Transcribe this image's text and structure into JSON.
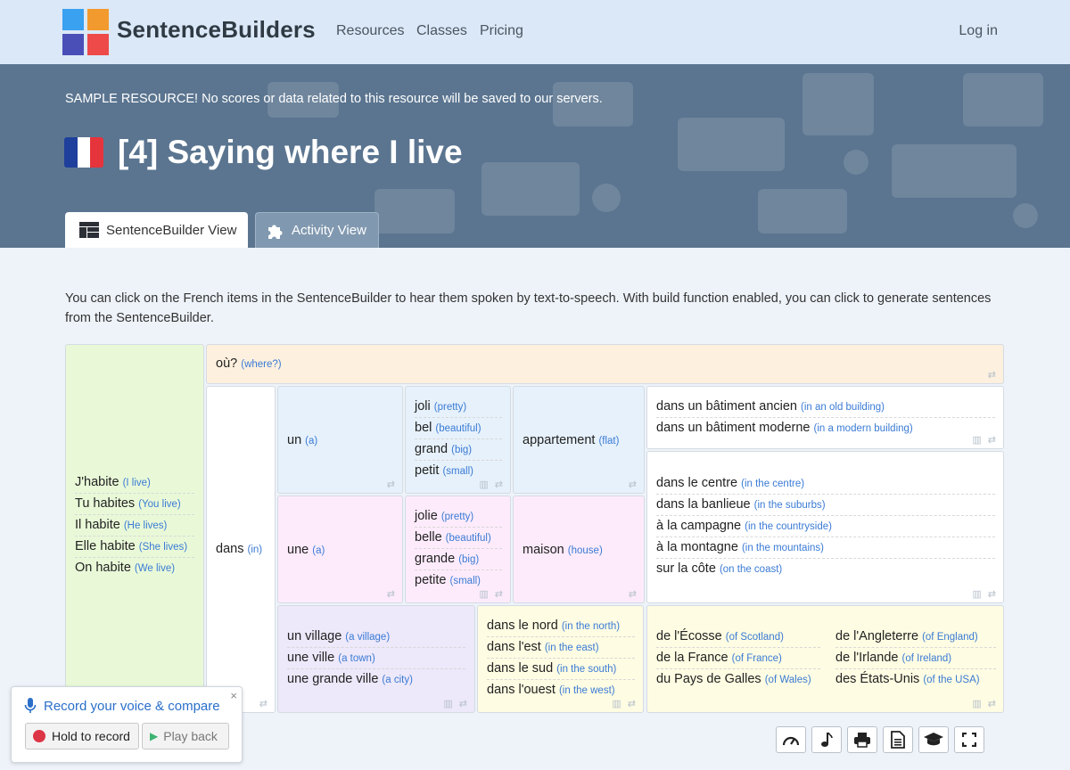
{
  "nav": {
    "brand": "SentenceBuilders",
    "links": [
      "Resources",
      "Classes",
      "Pricing"
    ],
    "login": "Log in",
    "logo_colors": [
      "#3aa0f0",
      "#f39a2e",
      "#4a4fb8",
      "#ee4a4a"
    ]
  },
  "hero": {
    "notice": "SAMPLE RESOURCE! No scores or data related to this resource will be saved to our servers.",
    "title": "[4] Saying where I live",
    "flag_colors": [
      "#1f3f9c",
      "#ffffff",
      "#e5343c"
    ],
    "tabs": [
      {
        "label": "SentenceBuilder View",
        "icon": "dashboard-icon",
        "active": true
      },
      {
        "label": "Activity View",
        "icon": "puzzle-icon",
        "active": false
      }
    ]
  },
  "intro": "You can click on the French items in the SentenceBuilder to hear them spoken by text-to-speech. With build function enabled, you can click to generate sentences from the SentenceBuilder.",
  "builder": {
    "subjects": [
      {
        "fr": "J'habite",
        "en": "(I live)"
      },
      {
        "fr": "Tu habites",
        "en": "(You live)"
      },
      {
        "fr": "Il habite",
        "en": "(He lives)"
      },
      {
        "fr": "Elle habite",
        "en": "(She lives)"
      },
      {
        "fr": "On habite",
        "en": "(We live)"
      }
    ],
    "question": {
      "fr": "où?",
      "en": "(where?)"
    },
    "dans": {
      "fr": "dans",
      "en": "(in)"
    },
    "un": {
      "fr": "un",
      "en": "(a)"
    },
    "une": {
      "fr": "une",
      "en": "(a)"
    },
    "adj_masc": [
      {
        "fr": "joli",
        "en": "(pretty)"
      },
      {
        "fr": "bel",
        "en": "(beautiful)"
      },
      {
        "fr": "grand",
        "en": "(big)"
      },
      {
        "fr": "petit",
        "en": "(small)"
      }
    ],
    "adj_fem": [
      {
        "fr": "jolie",
        "en": "(pretty)"
      },
      {
        "fr": "belle",
        "en": "(beautiful)"
      },
      {
        "fr": "grande",
        "en": "(big)"
      },
      {
        "fr": "petite",
        "en": "(small)"
      }
    ],
    "appartement": {
      "fr": "appartement",
      "en": "(flat)"
    },
    "maison": {
      "fr": "maison",
      "en": "(house)"
    },
    "buildings": [
      {
        "fr": "dans un bâtiment ancien",
        "en": "(in an old building)"
      },
      {
        "fr": "dans un bâtiment moderne",
        "en": "(in a modern building)"
      }
    ],
    "places": [
      {
        "fr": "dans le centre",
        "en": "(in the centre)"
      },
      {
        "fr": "dans la banlieue",
        "en": "(in the suburbs)"
      },
      {
        "fr": "à la campagne",
        "en": "(in the countryside)"
      },
      {
        "fr": "à la montagne",
        "en": "(in the mountains)"
      },
      {
        "fr": "sur la côte",
        "en": "(on the coast)"
      }
    ],
    "settlements": [
      {
        "fr": "un village",
        "en": "(a village)"
      },
      {
        "fr": "une ville",
        "en": "(a town)"
      },
      {
        "fr": "une grande ville",
        "en": "(a city)"
      }
    ],
    "directions": [
      {
        "fr": "dans le nord",
        "en": "(in the north)"
      },
      {
        "fr": "dans l'est",
        "en": "(in the east)"
      },
      {
        "fr": "dans le sud",
        "en": "(in the south)"
      },
      {
        "fr": "dans l'ouest",
        "en": "(in the west)"
      }
    ],
    "countries_left": [
      {
        "fr": "de l'Écosse",
        "en": "(of Scotland)"
      },
      {
        "fr": "de la France",
        "en": "(of France)"
      },
      {
        "fr": "du Pays de Galles",
        "en": "(of Wales)"
      }
    ],
    "countries_right": [
      {
        "fr": "de l'Angleterre",
        "en": "(of England)"
      },
      {
        "fr": "de l'Irlande",
        "en": "(of Ireland)"
      },
      {
        "fr": "des États-Unis",
        "en": "(of the USA)"
      }
    ],
    "colors": {
      "subjects": "#e9f9d8",
      "question": "#fdf0de",
      "blue": "#e6f1fb",
      "pink": "#fdebfb",
      "purple": "#ede8fa",
      "yellow": "#fefce2",
      "white": "#ffffff"
    }
  },
  "voice": {
    "title": "Record your voice & compare",
    "record": "Hold to record",
    "play": "Play back",
    "close": "×"
  },
  "toolbar": [
    "speed-icon",
    "music-icon",
    "print-icon",
    "document-icon",
    "graduation-cap-icon",
    "fullscreen-icon"
  ]
}
